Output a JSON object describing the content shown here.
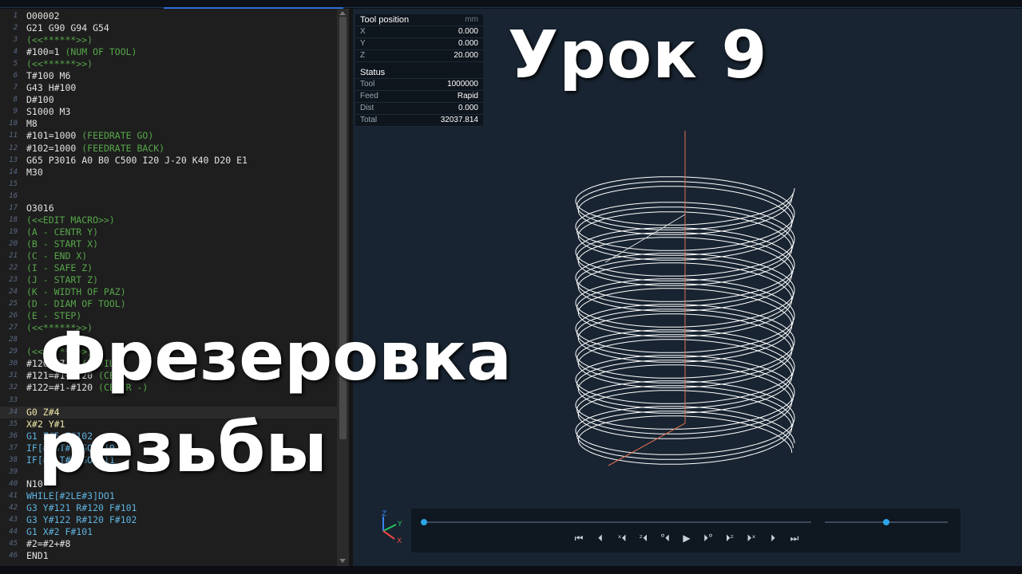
{
  "editor": {
    "lines": [
      {
        "n": "1",
        "segs": [
          {
            "t": "O00002",
            "c": "c-white"
          }
        ]
      },
      {
        "n": "2",
        "segs": [
          {
            "t": "G21 G90 G94 G54",
            "c": "c-white"
          }
        ]
      },
      {
        "n": "3",
        "segs": [
          {
            "t": "(<<******>>)",
            "c": "c-green"
          }
        ]
      },
      {
        "n": "4",
        "segs": [
          {
            "t": "#100=1 ",
            "c": "c-white"
          },
          {
            "t": "(NUM OF TOOL)",
            "c": "c-green"
          }
        ]
      },
      {
        "n": "5",
        "segs": [
          {
            "t": "(<<******>>)",
            "c": "c-green"
          }
        ]
      },
      {
        "n": "6",
        "segs": [
          {
            "t": "T#100 M6",
            "c": "c-white"
          }
        ]
      },
      {
        "n": "7",
        "segs": [
          {
            "t": "G43 H#100",
            "c": "c-white"
          }
        ]
      },
      {
        "n": "8",
        "segs": [
          {
            "t": "D#100",
            "c": "c-white"
          }
        ]
      },
      {
        "n": "9",
        "segs": [
          {
            "t": "S1000 M3",
            "c": "c-white"
          }
        ]
      },
      {
        "n": "10",
        "segs": [
          {
            "t": "M8",
            "c": "c-white"
          }
        ]
      },
      {
        "n": "11",
        "segs": [
          {
            "t": "#101=1000 ",
            "c": "c-white"
          },
          {
            "t": "(FEEDRATE GO)",
            "c": "c-green"
          }
        ]
      },
      {
        "n": "12",
        "segs": [
          {
            "t": "#102=1000 ",
            "c": "c-white"
          },
          {
            "t": "(FEEDRATE BACK)",
            "c": "c-green"
          }
        ]
      },
      {
        "n": "13",
        "segs": [
          {
            "t": "G65 P3016 A0 B0 C500 I20 J-20 K40 D20 E1",
            "c": "c-white"
          }
        ]
      },
      {
        "n": "14",
        "segs": [
          {
            "t": "M30",
            "c": "c-white"
          }
        ]
      },
      {
        "n": "15",
        "segs": []
      },
      {
        "n": "16",
        "segs": []
      },
      {
        "n": "17",
        "segs": [
          {
            "t": "O3016",
            "c": "c-white"
          }
        ]
      },
      {
        "n": "18",
        "segs": [
          {
            "t": "(<<EDIT MACRO>>)",
            "c": "c-green"
          }
        ]
      },
      {
        "n": "19",
        "segs": [
          {
            "t": "(A - CENTR Y)",
            "c": "c-green"
          }
        ]
      },
      {
        "n": "20",
        "segs": [
          {
            "t": "(B - START X)",
            "c": "c-green"
          }
        ]
      },
      {
        "n": "21",
        "segs": [
          {
            "t": "(C - END X)",
            "c": "c-green"
          }
        ]
      },
      {
        "n": "22",
        "segs": [
          {
            "t": "(I - SAFE Z)",
            "c": "c-green"
          }
        ]
      },
      {
        "n": "23",
        "segs": [
          {
            "t": "(J - START Z)",
            "c": "c-green"
          }
        ]
      },
      {
        "n": "24",
        "segs": [
          {
            "t": "(K - WIDTH OF PAZ)",
            "c": "c-green"
          }
        ]
      },
      {
        "n": "25",
        "segs": [
          {
            "t": "(D - DIAM OF TOOL)",
            "c": "c-green"
          }
        ]
      },
      {
        "n": "26",
        "segs": [
          {
            "t": "(E - STEP)",
            "c": "c-green"
          }
        ]
      },
      {
        "n": "27",
        "segs": [
          {
            "t": "(<<******>>)",
            "c": "c-green"
          }
        ]
      },
      {
        "n": "28",
        "segs": []
      },
      {
        "n": "29",
        "segs": [
          {
            "t": "(<<******>>)",
            "c": "c-green"
          }
        ]
      },
      {
        "n": "30",
        "segs": [
          {
            "t": "#120=#7/2 ",
            "c": "c-white"
          },
          {
            "t": "(RADIUS)",
            "c": "c-green"
          }
        ]
      },
      {
        "n": "31",
        "segs": [
          {
            "t": "#121=#1+#120 ",
            "c": "c-white"
          },
          {
            "t": "(CENTR +)",
            "c": "c-green"
          }
        ]
      },
      {
        "n": "32",
        "segs": [
          {
            "t": "#122=#1-#120 ",
            "c": "c-white"
          },
          {
            "t": "(CENTR -)",
            "c": "c-green"
          }
        ]
      },
      {
        "n": "33",
        "segs": []
      },
      {
        "n": "34",
        "segs": [
          {
            "t": "G0 Z#4",
            "c": "c-yellow"
          }
        ],
        "hl": true
      },
      {
        "n": "35",
        "segs": [
          {
            "t": "X#2 Y#1",
            "c": "c-yellow"
          }
        ]
      },
      {
        "n": "36",
        "segs": [
          {
            "t": "G1 Z#5 F#102",
            "c": "c-blue"
          }
        ]
      },
      {
        "n": "37",
        "segs": [
          {
            "t": "IF[#2GT#3]GOTO10",
            "c": "c-blue"
          }
        ]
      },
      {
        "n": "38",
        "segs": [
          {
            "t": "IF[#2LT#3]GOTO11",
            "c": "c-blue"
          }
        ]
      },
      {
        "n": "39",
        "segs": []
      },
      {
        "n": "40",
        "segs": [
          {
            "t": "N10",
            "c": "c-white"
          }
        ]
      },
      {
        "n": "41",
        "segs": [
          {
            "t": "WHILE[#2LE#3]DO1",
            "c": "c-blue"
          }
        ]
      },
      {
        "n": "42",
        "segs": [
          {
            "t": "G3 Y#121 R#120 F#101",
            "c": "c-blue"
          }
        ]
      },
      {
        "n": "43",
        "segs": [
          {
            "t": "G3 Y#122 R#120 F#102",
            "c": "c-blue"
          }
        ]
      },
      {
        "n": "44",
        "segs": [
          {
            "t": "G1 X#2 F#101",
            "c": "c-blue"
          }
        ]
      },
      {
        "n": "45",
        "segs": [
          {
            "t": "#2=#2+#8",
            "c": "c-white"
          }
        ]
      },
      {
        "n": "46",
        "segs": [
          {
            "t": "END1",
            "c": "c-white"
          }
        ]
      }
    ]
  },
  "tool_position": {
    "header": "Tool position",
    "unit": "mm",
    "x_label": "X",
    "x_value": "0.000",
    "y_label": "Y",
    "y_value": "0.000",
    "z_label": "Z",
    "z_value": "20.000"
  },
  "status": {
    "header": "Status",
    "tool_label": "Tool",
    "tool_value": "1000000",
    "feed_label": "Feed",
    "feed_value": "Rapid",
    "dist_label": "Dist",
    "dist_value": "0.000",
    "total_label": "Total",
    "total_value": "32037.814"
  },
  "overlay": {
    "title_main": "Урок 9",
    "title_line1": "Фрезеровка",
    "title_line2": "резьбы"
  },
  "gizmo": {
    "x": "X",
    "y": "Y",
    "z": "Z"
  },
  "player": {
    "progress": 0.0,
    "speed": 0.5,
    "controls": [
      "skip-start",
      "step-back",
      "step-back-x",
      "step-back-z",
      "step-back-all",
      "play",
      "step-fwd-all",
      "step-fwd-z",
      "step-fwd-x",
      "step-fwd",
      "skip-end"
    ]
  },
  "colors": {
    "comment": "#57a64a",
    "motion": "#5fb3e0",
    "rapid": "#e07050",
    "toolpath": "#ffffff",
    "accent": "#2ba6e8",
    "viewport_bg": "#182431"
  }
}
